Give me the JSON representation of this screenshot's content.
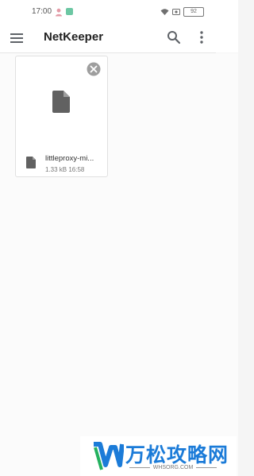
{
  "status_bar": {
    "time": "17:00",
    "battery_level": "92"
  },
  "app_bar": {
    "title": "NetKeeper",
    "icons": {
      "menu": "menu-icon",
      "search": "search-icon",
      "more": "more-vert-icon"
    }
  },
  "files": [
    {
      "name": "littleproxy-mi...",
      "meta": "1.33 kB 16:58"
    }
  ],
  "watermark": {
    "title": "万松攻略网",
    "subtitle": "WHSORG.COM"
  },
  "colors": {
    "accent": "#1b7bd8",
    "background": "#fbfbfb",
    "icon_gray": "#616161"
  }
}
